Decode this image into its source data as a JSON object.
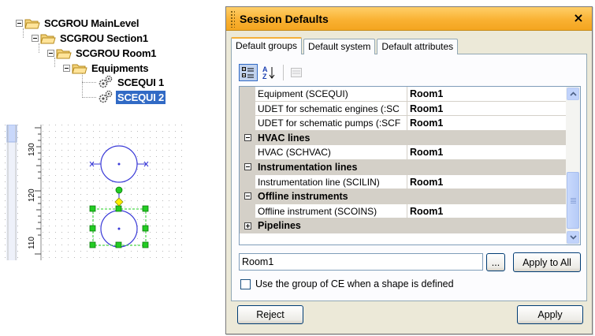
{
  "tree": {
    "items": [
      {
        "label": "SCGROU MainLevel",
        "icon": "folder-open-icon"
      },
      {
        "label": "SCGROU Section1",
        "icon": "folder-open-icon"
      },
      {
        "label": "SCGROU Room1",
        "icon": "folder-open-icon"
      },
      {
        "label": "Equipments",
        "icon": "folder-open-icon"
      },
      {
        "label": "SCEQUI 1",
        "icon": "gear-icon"
      },
      {
        "label": "SCEQUI 2",
        "icon": "gear-icon",
        "selected": true
      }
    ]
  },
  "ruler": {
    "labels": [
      "130",
      "120",
      "110"
    ]
  },
  "dialog": {
    "title": "Session Defaults",
    "close_label": "×",
    "tabs": [
      {
        "label": "Default groups",
        "active": true
      },
      {
        "label": "Default system",
        "active": false
      },
      {
        "label": "Default attributes",
        "active": false
      }
    ],
    "toolbar": {
      "categorized_icon": "categorized-icon",
      "alphabetical_icon": "sort-az-icon",
      "property_pages_icon": "property-pages-icon"
    },
    "grid_rows": [
      {
        "type": "property",
        "name": "Equipment (SCEQUI)",
        "value": "Room1"
      },
      {
        "type": "property",
        "name": "UDET for schematic engines (:SC",
        "value": "Room1"
      },
      {
        "type": "property",
        "name": "UDET for schematic pumps (:SCF",
        "value": "Room1"
      },
      {
        "type": "category",
        "name": "HVAC lines",
        "expanded": true
      },
      {
        "type": "property",
        "name": "HVAC (SCHVAC)",
        "value": "Room1"
      },
      {
        "type": "category",
        "name": "Instrumentation lines",
        "expanded": true
      },
      {
        "type": "property",
        "name": "Instrumentation line (SCILIN)",
        "value": "Room1"
      },
      {
        "type": "category",
        "name": "Offline instruments",
        "expanded": true
      },
      {
        "type": "property",
        "name": "Offline instrument (SCOINS)",
        "value": "Room1"
      },
      {
        "type": "category",
        "name": "Pipelines",
        "expanded": false
      }
    ],
    "value_input": "Room1",
    "browse_label": "...",
    "apply_all_label": "Apply to All",
    "checkbox_label": "Use the group of CE when a shape is defined",
    "reject_label": "Reject",
    "apply_label": "Apply"
  },
  "colors": {
    "title_bar": "#f9b233",
    "selection": "#316ac5",
    "active_tab_accent": "#f4b03a",
    "shape_stroke": "#3a3ad8",
    "handle_fill": "#22cc22",
    "diamond_fill": "#ffee00"
  }
}
